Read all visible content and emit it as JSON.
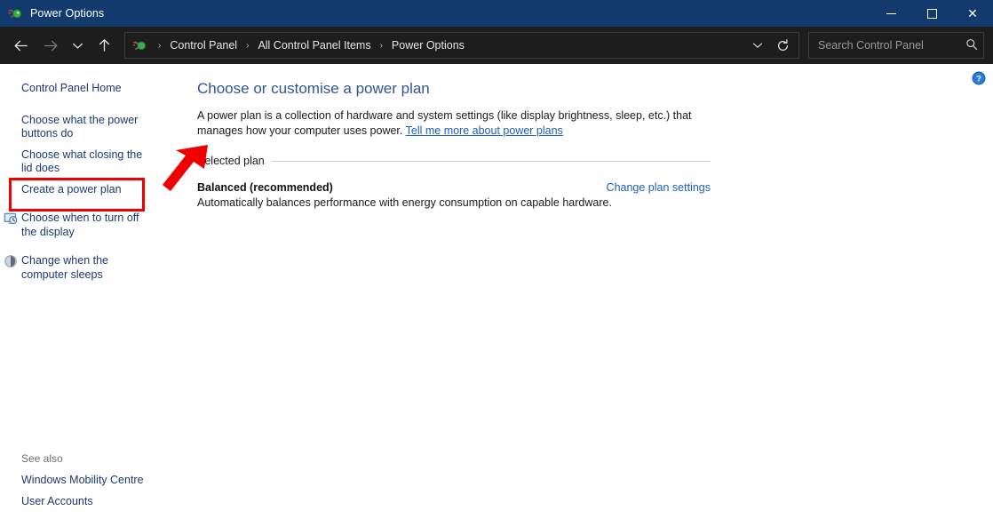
{
  "window": {
    "title": "Power Options",
    "app_icon": "power-plug-icon",
    "controls": {
      "minimize": "Minimize",
      "maximize": "Maximize",
      "close": "Close"
    },
    "titlebar_color": "#123a6d",
    "toolbar_color": "#1d1d1d"
  },
  "toolbar": {
    "back": "back-arrow-icon",
    "forward": "forward-arrow-icon",
    "recent": "chevron-down-icon",
    "up": "up-arrow-icon",
    "address_icon": "power-plug-icon",
    "breadcrumbs": [
      "Control Panel",
      "All Control Panel Items",
      "Power Options"
    ],
    "breadcrumb_separator": "›",
    "dropdown": "chevron-down-icon",
    "refresh": "refresh-icon"
  },
  "search": {
    "placeholder": "Search Control Panel",
    "value": "",
    "icon": "search-icon"
  },
  "sidebar": {
    "home": "Control Panel Home",
    "items": [
      {
        "label": "Choose what the power buttons do",
        "icon": "",
        "highlighted": true
      },
      {
        "label": "Choose what closing the lid does",
        "icon": ""
      },
      {
        "label": "Create a power plan",
        "icon": ""
      },
      {
        "label": "Choose when to turn off the display",
        "icon": "monitor-clock-icon"
      },
      {
        "label": "Change when the computer sleeps",
        "icon": "moon-sleep-icon"
      }
    ],
    "see_also": {
      "title": "See also",
      "items": [
        "Windows Mobility Centre",
        "User Accounts"
      ]
    }
  },
  "main": {
    "heading": "Choose or customise a power plan",
    "intro_text": "A power plan is a collection of hardware and system settings (like display brightness, sleep, etc.) that manages how your computer uses power. ",
    "intro_link": "Tell me more about power plans",
    "section_label": "Selected plan",
    "plan": {
      "name": "Balanced (recommended)",
      "change_link": "Change plan settings",
      "description": "Automatically balances performance with energy consumption on capable hardware."
    },
    "help_icon": "help-question-icon"
  },
  "annotations": {
    "highlight_color": "#f20000",
    "arrow_color": "#f20000",
    "highlight_target": "Choose what the power buttons do"
  }
}
